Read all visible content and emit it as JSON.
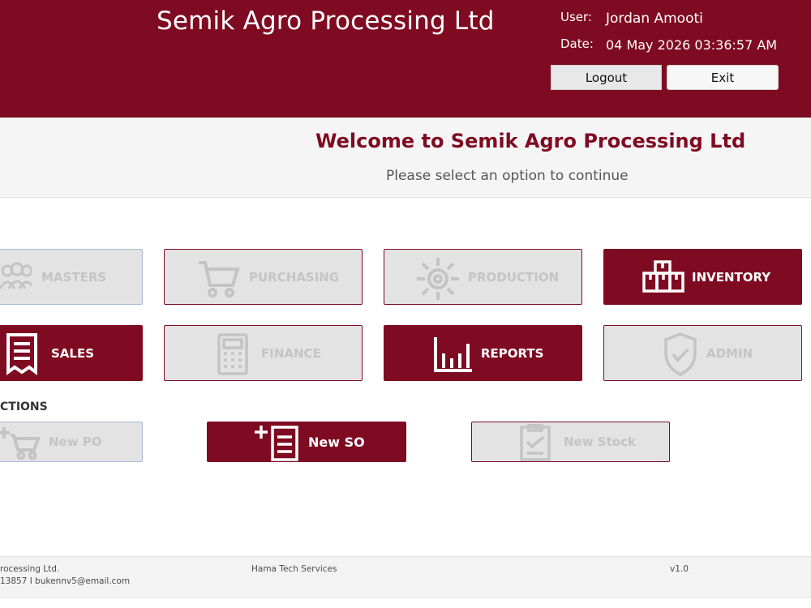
{
  "header": {
    "app_title": "Semik Agro Processing Ltd",
    "user_label": "User:",
    "user_value": "Jordan Amooti",
    "date_label": "Date:",
    "date_value": "04 May 2026  03:36:57 AM",
    "logout_label": "Logout",
    "exit_label": "Exit"
  },
  "welcome": {
    "title": "Welcome to Semik Agro Processing Ltd",
    "subtitle": "Please select an option to continue"
  },
  "modules": [
    {
      "label": "MASTERS",
      "icon": "users-icon",
      "state": "disabled"
    },
    {
      "label": "PURCHASING",
      "icon": "cart-icon",
      "state": "disabled"
    },
    {
      "label": "PRODUCTION",
      "icon": "gear-icon",
      "state": "disabled"
    },
    {
      "label": "INVENTORY",
      "icon": "boxes-icon",
      "state": "active"
    },
    {
      "label": "SALES",
      "icon": "receipt-icon",
      "state": "active"
    },
    {
      "label": "FINANCE",
      "icon": "calculator-icon",
      "state": "disabled"
    },
    {
      "label": "REPORTS",
      "icon": "bar-chart-icon",
      "state": "active"
    },
    {
      "label": "ADMIN",
      "icon": "shield-icon",
      "state": "disabled"
    }
  ],
  "quick_actions": {
    "section_label": "CTIONS",
    "items": [
      {
        "label": "New PO",
        "icon": "cart-plus-icon",
        "state": "disabled"
      },
      {
        "label": "New SO",
        "icon": "add-document-icon",
        "state": "active"
      },
      {
        "label": "New Stock",
        "icon": "clipboard-check-icon",
        "state": "disabled"
      }
    ]
  },
  "footer": {
    "company_line": "rocessing Ltd.",
    "contact_line": "13857  I  bukennv5@email.com",
    "vendor": "Hama Tech Services",
    "version": "v1.0"
  },
  "colors": {
    "brand": "#7f0b22",
    "disabled_bg": "#e3e3e3",
    "disabled_text": "#c4c4c4"
  }
}
